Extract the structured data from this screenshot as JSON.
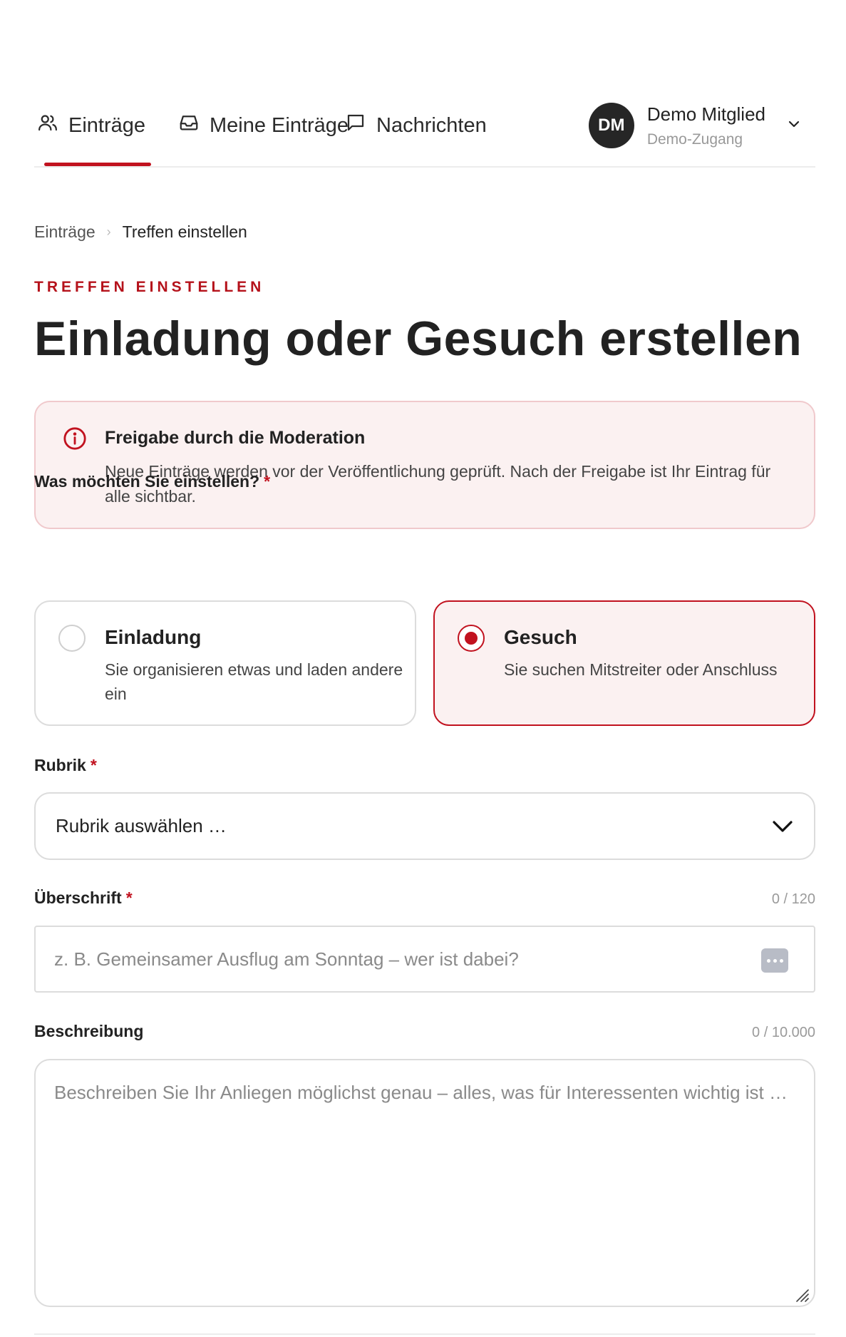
{
  "nav": {
    "tabs": [
      {
        "label": "Einträge",
        "icon": "users-icon",
        "active": true
      },
      {
        "label": "Meine Einträge",
        "icon": "inbox-icon",
        "active": false
      },
      {
        "label": "Nachrichten",
        "icon": "message-icon",
        "active": false
      }
    ],
    "user": {
      "initials": "DM",
      "name": "Demo Mitglied",
      "subtitle": "Demo-Zugang",
      "icon": "chevron-down-icon"
    }
  },
  "breadcrumb": {
    "items": [
      "Einträge",
      "Treffen einstellen"
    ],
    "separator": "›"
  },
  "header": {
    "eyebrow": "TREFFEN EINSTELLEN",
    "title": "Einladung oder Gesuch erstellen"
  },
  "info": {
    "icon": "info-icon",
    "title": "Freigabe durch die Moderation",
    "text": "Neue Einträge werden vor der Veröffentlichung geprüft. Nach der Freigabe ist Ihr Eintrag für alle sichtbar."
  },
  "type_choice": {
    "label": "Was möchten Sie einstellen?",
    "required_mark": "*",
    "options": [
      {
        "title": "Einladung",
        "description": "Sie organisieren etwas und laden andere ein",
        "selected": false
      },
      {
        "title": "Gesuch",
        "description": "Sie suchen Mitstreiter oder Anschluss",
        "selected": true
      }
    ]
  },
  "category": {
    "label": "Rubrik",
    "required_mark": "*",
    "value": "Rubrik auswählen …"
  },
  "headline": {
    "label": "Überschrift",
    "required_mark": "*",
    "counter": "0 / 120",
    "value": "",
    "placeholder": "z. B. Gemeinsamer Ausflug am Sonntag – wer ist dabei?"
  },
  "description": {
    "label": "Beschreibung",
    "counter": "0 / 10.000",
    "value": "",
    "placeholder": "Beschreiben Sie Ihr Anliegen möglichst genau – alles, was für Interessenten wichtig ist …"
  },
  "colors": {
    "accent": "#c1121f",
    "accent_bg": "#fbf1f1",
    "border": "#dcdcdc"
  }
}
